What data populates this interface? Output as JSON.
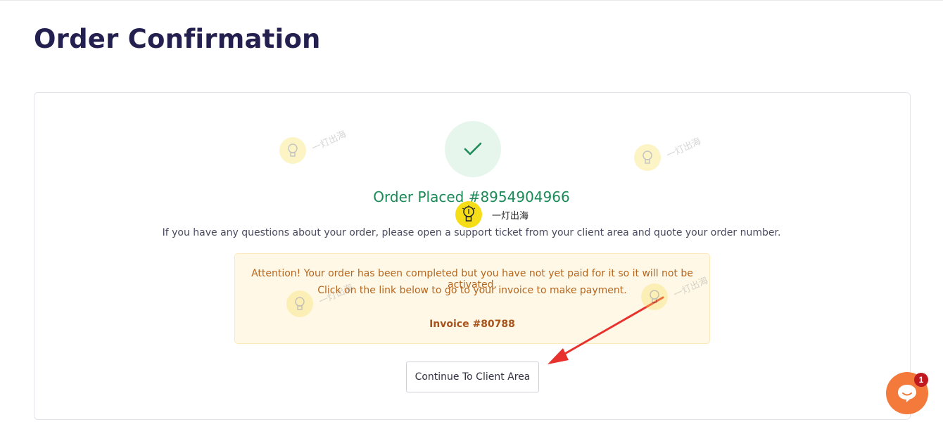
{
  "page": {
    "title": "Order Confirmation"
  },
  "confirmation": {
    "heading": "Order Placed #8954904966",
    "info": "If you have any questions about your order, please open a support ticket from your client area and quote your order number.",
    "check_color": "#1c8a57"
  },
  "alert": {
    "line1": "Attention! Your order has been completed but you have not yet paid for it so it will not be activated.",
    "line2": "Click on the link below to go to your invoice to make payment.",
    "invoice_link": "Invoice #80788"
  },
  "actions": {
    "continue_label": "Continue To Client Area"
  },
  "chat": {
    "icon": "chat-bubble-icon",
    "badge_count": "1",
    "color": "#f47a3c"
  },
  "watermark": {
    "text": "一灯出海",
    "icon": "lightbulb-icon"
  },
  "annotation": {
    "arrow_color": "#e8322e"
  }
}
